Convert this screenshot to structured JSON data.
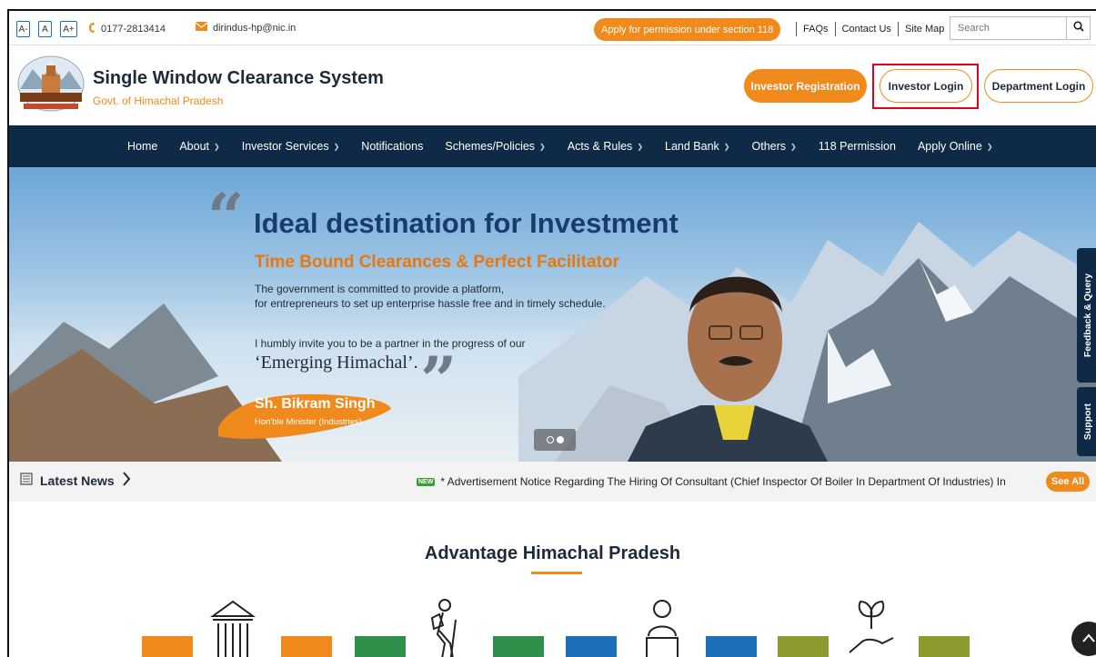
{
  "topbar": {
    "font_small": "A-",
    "font_normal": "A",
    "font_large": "A+",
    "phone": "0177-2813414",
    "email": "dirindus-hp@nic.in",
    "apply_pill": "Apply for permission under section 118",
    "links": [
      "FAQs",
      "Contact Us",
      "Site Map"
    ],
    "search_placeholder": "Search"
  },
  "header": {
    "title": "Single Window Clearance System",
    "subtitle": "Govt. of Himachal Pradesh",
    "investor_registration": "Investor Registration",
    "investor_login": "Investor Login",
    "department_login": "Department Login"
  },
  "nav": {
    "items": [
      {
        "label": "Home",
        "dropdown": false
      },
      {
        "label": "About",
        "dropdown": true
      },
      {
        "label": "Investor Services",
        "dropdown": true
      },
      {
        "label": "Notifications",
        "dropdown": false
      },
      {
        "label": "Schemes/Policies",
        "dropdown": true
      },
      {
        "label": "Acts & Rules",
        "dropdown": true
      },
      {
        "label": "Land Bank",
        "dropdown": true
      },
      {
        "label": "Others",
        "dropdown": true
      },
      {
        "label": "118 Permission",
        "dropdown": false
      },
      {
        "label": "Apply Online",
        "dropdown": true
      }
    ]
  },
  "hero": {
    "heading": "Ideal destination for Investment",
    "subheading": "Time Bound Clearances & Perfect Facilitator",
    "para_line1": "The government is committed to provide a platform,",
    "para_line2": "for entrepreneurs to set up enterprise hassle free and in timely schedule.",
    "invite": "I humbly invite you to be a partner in the progress of our",
    "emerging": "‘Emerging Himachal’.",
    "minister_name": "Sh. Bikram Singh",
    "minister_role": "Hon'ble Minister (Industries)"
  },
  "side_tabs": {
    "feedback": "Feedback & Query",
    "support": "Support"
  },
  "news": {
    "label": "Latest News",
    "badge": "NEW",
    "text": "* Advertisement Notice Regarding The Hiring Of Consultant (Chief Inspector Of Boiler In Department Of Industries) In",
    "see_all": "See All"
  },
  "advantage": {
    "title": "Advantage Himachal Pradesh"
  },
  "colors": {
    "accent": "#f08a1c",
    "navy": "#0f2a47",
    "highlight": "#e3001b"
  }
}
